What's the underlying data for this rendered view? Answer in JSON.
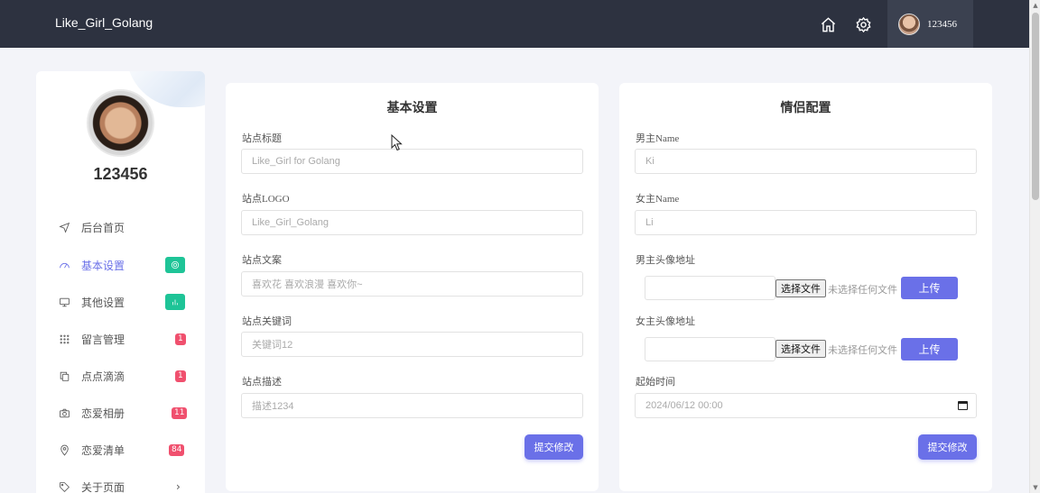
{
  "header": {
    "brand": "Like_Girl_Golang",
    "username": "123456"
  },
  "sidebar": {
    "username": "123456",
    "items": [
      {
        "label": "后台首页",
        "icon": "send-icon"
      },
      {
        "label": "基本设置",
        "icon": "gauge-icon",
        "active": true
      },
      {
        "label": "其他设置",
        "icon": "monitor-icon"
      },
      {
        "label": "留言管理",
        "icon": "grid-icon",
        "badge": "1"
      },
      {
        "label": "点点滴滴",
        "icon": "copy-icon",
        "badge": "1"
      },
      {
        "label": "恋爱相册",
        "icon": "camera-icon",
        "badge": "11"
      },
      {
        "label": "恋爱清单",
        "icon": "map-pin-icon",
        "badge": "84"
      },
      {
        "label": "关于页面",
        "icon": "tag-icon"
      }
    ]
  },
  "basic": {
    "title": "基本设置",
    "site_title_label": "站点标题",
    "site_title_value": "Like_Girl for Golang",
    "site_logo_label": "站点LOGO",
    "site_logo_value": "Like_Girl_Golang",
    "site_copy_label": "站点文案",
    "site_copy_value": "喜欢花 喜欢浪漫 喜欢你~",
    "site_keywords_label": "站点关键词",
    "site_keywords_value": "关键词12",
    "site_desc_label": "站点描述",
    "site_desc_value": "描述1234",
    "submit_label": "提交修改"
  },
  "couple": {
    "title": "情侣配置",
    "male_name_label": "男主Name",
    "male_name_value": "Ki",
    "female_name_label": "女主Name",
    "female_name_value": "Li",
    "male_avatar_label": "男主头像地址",
    "female_avatar_label": "女主头像地址",
    "choose_file_label": "选择文件",
    "no_file_label": "未选择任何文件",
    "upload_label": "上传",
    "start_time_label": "起始时间",
    "start_time_value": "2024/06/12 00:00",
    "submit_label": "提交修改"
  },
  "colors": {
    "accent": "#6a70e8",
    "topbar": "#2d3240",
    "badge_green": "#1ec497",
    "badge_red": "#f0506e"
  }
}
